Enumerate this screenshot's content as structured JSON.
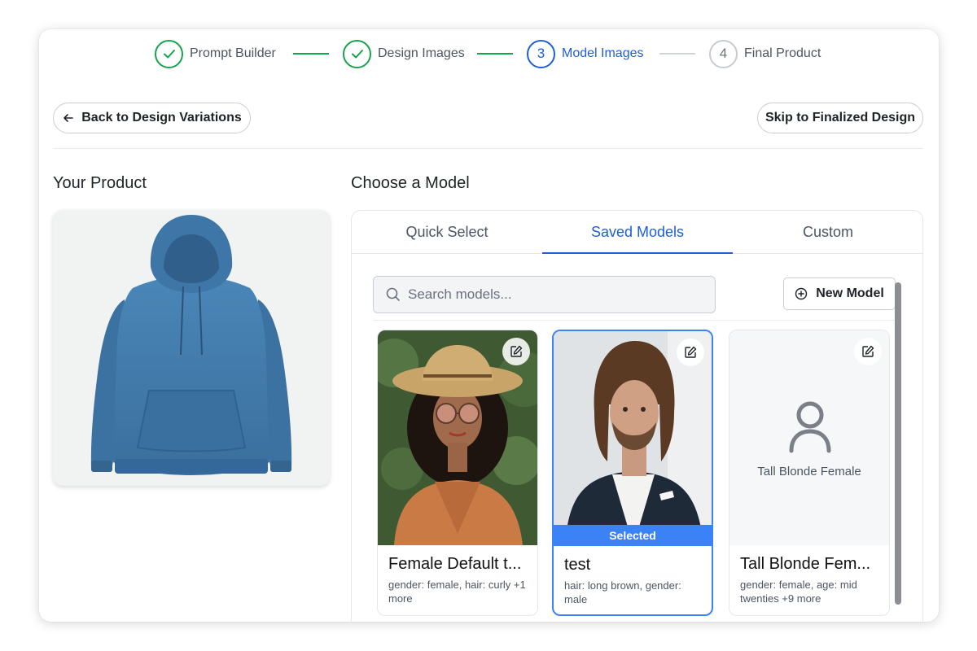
{
  "stepper": {
    "steps": [
      {
        "num": "1",
        "label": "Prompt Builder",
        "state": "done"
      },
      {
        "num": "2",
        "label": "Design Images",
        "state": "done"
      },
      {
        "num": "3",
        "label": "Model Images",
        "state": "active"
      },
      {
        "num": "4",
        "label": "Final Product",
        "state": "pending"
      }
    ]
  },
  "header": {
    "back_label": "Back to Design Variations",
    "skip_label": "Skip to Finalized Design"
  },
  "product": {
    "title": "Your Product"
  },
  "models": {
    "title": "Choose a Model",
    "tabs": [
      {
        "label": "Quick Select"
      },
      {
        "label": "Saved Models"
      },
      {
        "label": "Custom"
      }
    ],
    "active_tab": "Saved Models",
    "search_placeholder": "Search models...",
    "new_model_label": "New Model",
    "cards": [
      {
        "name": "Female Default t...",
        "meta": "gender: female, hair: curly +1 more",
        "selected": false
      },
      {
        "name": "test",
        "meta": "hair: long brown, gender: male",
        "selected": true,
        "badge": "Selected"
      },
      {
        "name": "Tall Blonde Fem...",
        "meta": "gender: female, age: mid twenties +9 more",
        "selected": false,
        "placeholder_label": "Tall Blonde Female"
      }
    ]
  },
  "colors": {
    "accent": "#1d5fd8",
    "done": "#16a34a",
    "selected": "#3b82f6",
    "product": "#3f78a8"
  }
}
